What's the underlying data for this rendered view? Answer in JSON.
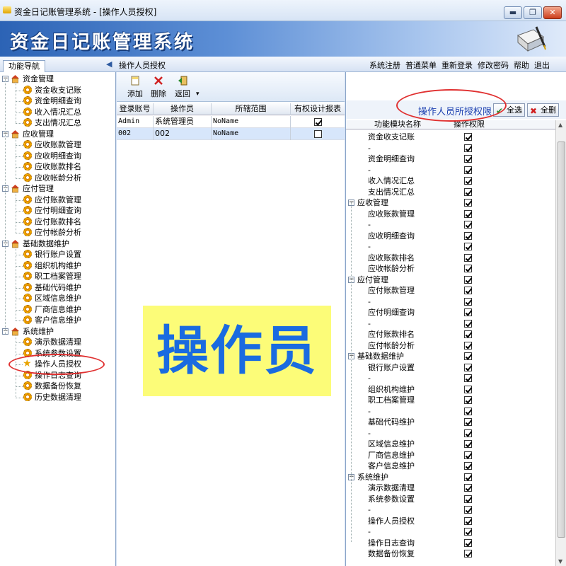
{
  "window": {
    "title": "资金日记账管理系统 - [操作人员授权]",
    "min_glyph": "▬",
    "max_glyph": "❐",
    "close_glyph": "✕"
  },
  "banner": {
    "app_name": "资金日记账管理系统"
  },
  "nav": {
    "tab_label": "功能导航",
    "page_title": "操作人员授权",
    "top_menu": [
      "系统注册",
      "普通菜单",
      "重新登录",
      "修改密码",
      "帮助",
      "退出"
    ]
  },
  "tree": [
    {
      "label": "资金管理",
      "children": [
        "资金收支记账",
        "资金明细查询",
        "收入情况汇总",
        "支出情况汇总"
      ]
    },
    {
      "label": "应收管理",
      "children": [
        "应收账款管理",
        "应收明细查询",
        "应收账款排名",
        "应收帐龄分析"
      ]
    },
    {
      "label": "应付管理",
      "children": [
        "应付账款管理",
        "应付明细查询",
        "应付账款排名",
        "应付帐龄分析"
      ]
    },
    {
      "label": "基础数据维护",
      "children": [
        "银行账户设置",
        "组织机构维护",
        "职工档案管理",
        "基础代码维护",
        "区域信息维护",
        "厂商信息维护",
        "客户信息维护"
      ]
    },
    {
      "label": "系统维护",
      "children": [
        "演示数据清理",
        "系统参数设置",
        "操作人员授权",
        "操作日志查询",
        "数据备份恢复",
        "历史数据清理"
      ]
    }
  ],
  "selected_tree_item": "操作人员授权",
  "toolbar": {
    "add_label": "添加",
    "delete_label": "删除",
    "back_label": "返回",
    "more_glyph": "▾"
  },
  "users_table": {
    "headers": [
      "登录账号",
      "操作员",
      "所辖范围",
      "有权设计报表"
    ],
    "rows": [
      {
        "account": "Admin",
        "operator": "系统管理员",
        "scope": "NoName",
        "design": true
      },
      {
        "account": "002",
        "operator": "002",
        "scope": "NoName",
        "design": false
      }
    ]
  },
  "overlay_label": "操作员",
  "perm_panel": {
    "title": "操作人员所授权限",
    "select_all_label": "全选",
    "delete_all_label": "全删",
    "headers": [
      "功能模块名称",
      "操作权限"
    ],
    "rows": [
      {
        "label": "资金收支记账",
        "group": false,
        "checked": true
      },
      {
        "label": "-",
        "group": false,
        "checked": true
      },
      {
        "label": "资金明细查询",
        "group": false,
        "checked": true
      },
      {
        "label": "-",
        "group": false,
        "checked": true
      },
      {
        "label": "收入情况汇总",
        "group": false,
        "checked": true
      },
      {
        "label": "支出情况汇总",
        "group": false,
        "checked": true
      },
      {
        "label": "应收管理",
        "group": true,
        "checked": true
      },
      {
        "label": "应收账款管理",
        "group": false,
        "checked": true
      },
      {
        "label": "-",
        "group": false,
        "checked": true
      },
      {
        "label": "应收明细查询",
        "group": false,
        "checked": true
      },
      {
        "label": "-",
        "group": false,
        "checked": true
      },
      {
        "label": "应收账款排名",
        "group": false,
        "checked": true
      },
      {
        "label": "应收帐龄分析",
        "group": false,
        "checked": true
      },
      {
        "label": "应付管理",
        "group": true,
        "checked": true
      },
      {
        "label": "应付账款管理",
        "group": false,
        "checked": true
      },
      {
        "label": "-",
        "group": false,
        "checked": true
      },
      {
        "label": "应付明细查询",
        "group": false,
        "checked": true
      },
      {
        "label": "-",
        "group": false,
        "checked": true
      },
      {
        "label": "应付账款排名",
        "group": false,
        "checked": true
      },
      {
        "label": "应付帐龄分析",
        "group": false,
        "checked": true
      },
      {
        "label": "基础数据维护",
        "group": true,
        "checked": true
      },
      {
        "label": "银行账户设置",
        "group": false,
        "checked": true
      },
      {
        "label": "-",
        "group": false,
        "checked": true
      },
      {
        "label": "组织机构维护",
        "group": false,
        "checked": true
      },
      {
        "label": "职工档案管理",
        "group": false,
        "checked": true
      },
      {
        "label": "-",
        "group": false,
        "checked": true
      },
      {
        "label": "基础代码维护",
        "group": false,
        "checked": true
      },
      {
        "label": "-",
        "group": false,
        "checked": true
      },
      {
        "label": "区域信息维护",
        "group": false,
        "checked": true
      },
      {
        "label": "厂商信息维护",
        "group": false,
        "checked": true
      },
      {
        "label": "客户信息维护",
        "group": false,
        "checked": true
      },
      {
        "label": "系统维护",
        "group": true,
        "checked": true
      },
      {
        "label": "演示数据清理",
        "group": false,
        "checked": true
      },
      {
        "label": "系统参数设置",
        "group": false,
        "checked": true
      },
      {
        "label": "-",
        "group": false,
        "checked": true
      },
      {
        "label": "操作人员授权",
        "group": false,
        "checked": true
      },
      {
        "label": "-",
        "group": false,
        "checked": true
      },
      {
        "label": "操作日志查询",
        "group": false,
        "checked": true
      },
      {
        "label": "数据备份恢复",
        "group": false,
        "checked": true
      }
    ]
  },
  "colors": {
    "accent": "#1a6be0",
    "overlay_bg": "#fcfc78",
    "annotation_ring": "#e03030"
  }
}
